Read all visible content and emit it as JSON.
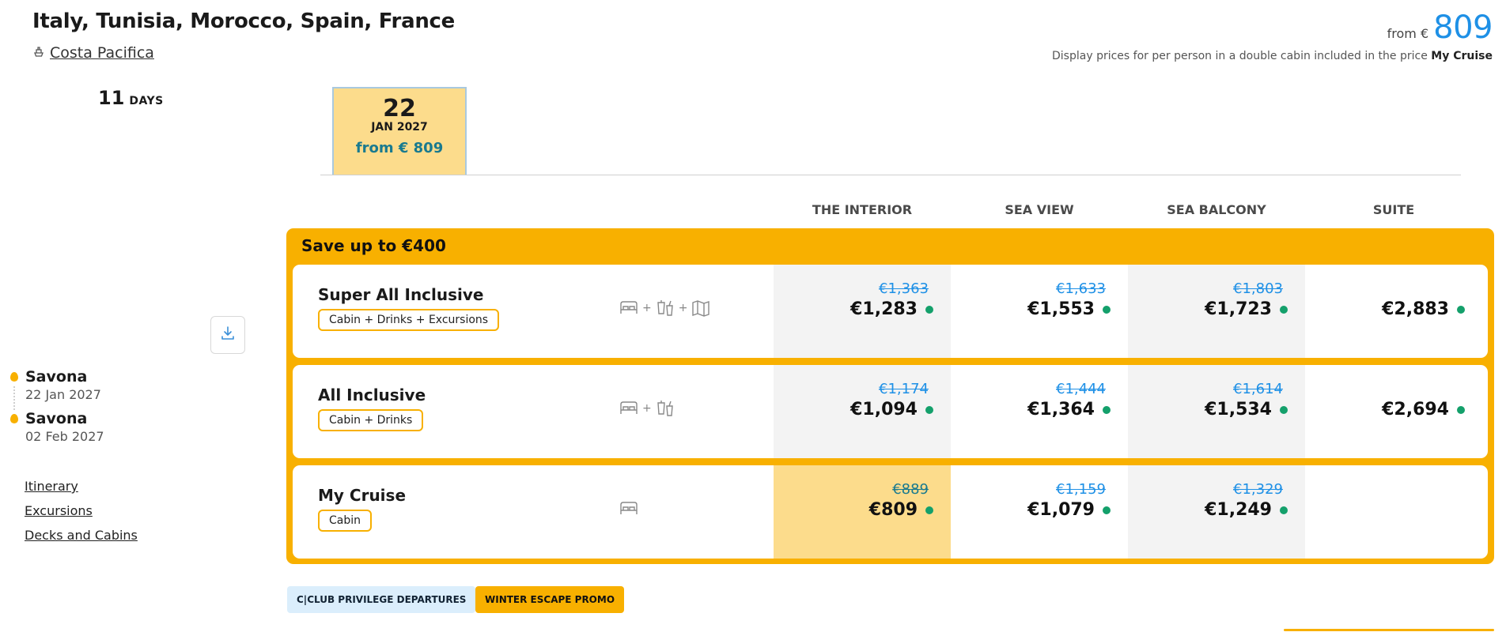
{
  "header": {
    "title": "Italy, Tunisia, Morocco, Spain, France",
    "ship": "Costa Pacifica",
    "price_from_label": "from €",
    "price_from_value": "809",
    "display_note": "Display prices for per person in a double cabin included in the price",
    "display_note_bold": "My Cruise"
  },
  "duration": {
    "value": "11",
    "unit": "DAYS"
  },
  "date_tab": {
    "day": "22",
    "month_year": "JAN 2027",
    "from_price": "from € 809"
  },
  "columns": [
    "THE INTERIOR",
    "SEA VIEW",
    "SEA BALCONY",
    "SUITE"
  ],
  "promo": {
    "title": "Save up to €400",
    "packages": [
      {
        "name": "Super All Inclusive",
        "tag": "Cabin + Drinks + Excursions",
        "prices": [
          {
            "old": "€1,363",
            "new": "€1,283"
          },
          {
            "old": "€1,633",
            "new": "€1,553"
          },
          {
            "old": "€1,803",
            "new": "€1,723"
          },
          {
            "old": "",
            "new": "€2,883"
          }
        ]
      },
      {
        "name": "All Inclusive",
        "tag": "Cabin + Drinks",
        "prices": [
          {
            "old": "€1,174",
            "new": "€1,094"
          },
          {
            "old": "€1,444",
            "new": "€1,364"
          },
          {
            "old": "€1,614",
            "new": "€1,534"
          },
          {
            "old": "",
            "new": "€2,694"
          }
        ]
      },
      {
        "name": "My Cruise",
        "tag": "Cabin",
        "prices": [
          {
            "old": "€889",
            "new": "€809"
          },
          {
            "old": "€1,159",
            "new": "€1,079"
          },
          {
            "old": "€1,329",
            "new": "€1,249"
          },
          {
            "old": "",
            "new": ""
          }
        ]
      }
    ]
  },
  "route": {
    "departure": {
      "port": "Savona",
      "date": "22 Jan 2027"
    },
    "arrival": {
      "port": "Savona",
      "date": "02 Feb 2027"
    }
  },
  "links": [
    "Itinerary",
    "Excursions",
    "Decks and Cabins"
  ],
  "badges": [
    "C|CLUB PRIVILEGE DEPARTURES",
    "WINTER ESCAPE PROMO"
  ],
  "icons": {
    "ship": "ship-icon",
    "download": "download-icon",
    "cabin": "bed-icon",
    "drinks": "drinks-icon",
    "excursions": "map-icon",
    "pin": "location-pin-icon"
  },
  "colors": {
    "accent": "#f8b000",
    "price_blue": "#1e90e6",
    "highlight": "#fcdc8c",
    "available": "#14a06b"
  }
}
